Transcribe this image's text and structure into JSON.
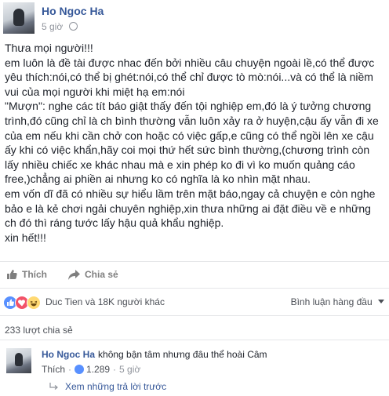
{
  "post": {
    "author": "Ho Ngoc Ha",
    "time": "5 giờ",
    "paragraphs": [
      "Thưa mọi người!!!",
      "em luôn là đề tài được nhac đến bởi nhiều câu chuyện ngoài lề,có thể được yêu thích:nói,có thể bị ghét:nói,có thể chỉ được tò mò:nói...và có thể là niềm vui của mọi người khi miệt hạ em:nói",
      "\"Mượn\": nghe các tít báo giật thấy đến tội nghiệp em,đó là ý tưởng chương trình,đó cũng chỉ là ch bình thường vẫn luôn xảy ra ở huyện,cậu ấy vẫn đi xe của em nếu khi cần chở con hoặc có việc gấp,e cũng có thể ngồi lên xe cậu ấy khi có việc khẩn,hãy coi mọi thứ hết sức bình thường,(chương trình còn lấy nhiều chiếc xe khác nhau mà e xin phép ko đi vì ko muốn quảng cáo free,)chẳng ai phiền ai nhưng ko có nghĩa là ko nhìn mặt nhau.",
      "em vốn dĩ đã có nhiều sự hiểu lầm trên mặt báo,ngay cả chuyện e còn nghe bảo e là kẻ chơi ngải chuyên nghiệp,xin thưa những ai đặt điều về e những ch đó thì ráng tước lấy hậu quả khẩu nghiệp.",
      "xin hết!!!"
    ]
  },
  "actions": {
    "like": "Thích",
    "share": "Chia sẻ"
  },
  "reactions": {
    "summary": "Duc Tien và 18K người khác"
  },
  "ranking": "Bình luận hàng đầu",
  "shares": "233 lượt chia sẻ",
  "comment": {
    "author": "Ho Ngoc Ha",
    "text": "không bận tâm nhưng đâu thể hoài Câm",
    "like": "Thích",
    "likes": "1.289",
    "time": "5 giờ",
    "more_replies": "Xem những trả lời trước"
  },
  "colors": {
    "link": "#365899",
    "muted": "#90949c",
    "like_blue": "#5890ff"
  },
  "icons": [
    "globe-icon",
    "thumbs-up-icon",
    "share-arrow-icon",
    "like-reaction-icon",
    "love-reaction-icon",
    "haha-reaction-icon",
    "chevron-down-icon",
    "reply-arrow-icon"
  ]
}
